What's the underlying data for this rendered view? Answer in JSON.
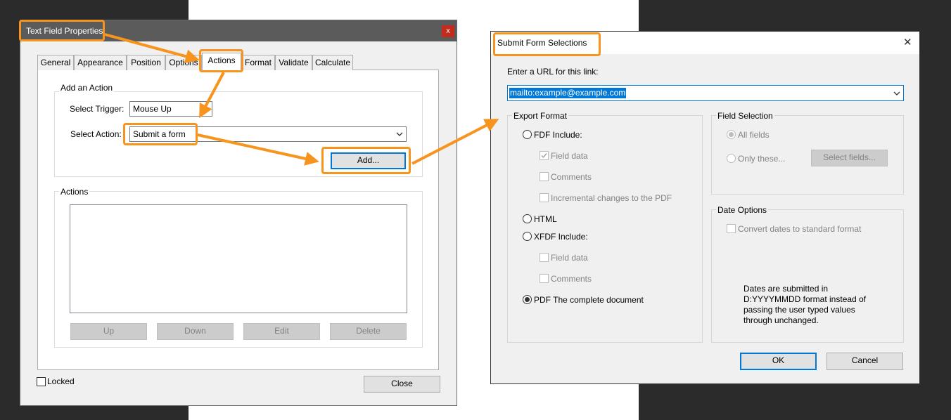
{
  "textFieldDialog": {
    "title": "Text Field Properties",
    "close_glyph": "x",
    "tabs": [
      {
        "label": "General",
        "active": false
      },
      {
        "label": "Appearance",
        "active": false
      },
      {
        "label": "Position",
        "active": false
      },
      {
        "label": "Options",
        "active": false
      },
      {
        "label": "Actions",
        "active": true
      },
      {
        "label": "Format",
        "active": false
      },
      {
        "label": "Validate",
        "active": false
      },
      {
        "label": "Calculate",
        "active": false
      }
    ],
    "addAction": {
      "group_label": "Add an Action",
      "trigger_label": "Select Trigger:",
      "trigger_value": "Mouse Up",
      "action_label": "Select Action:",
      "action_value": "Submit a form",
      "add_button": "Add..."
    },
    "actions": {
      "group_label": "Actions",
      "up_button": "Up",
      "down_button": "Down",
      "edit_button": "Edit",
      "delete_button": "Delete"
    },
    "locked_label": "Locked",
    "close_button": "Close"
  },
  "submitDialog": {
    "title": "Submit Form Selections",
    "close_glyph": "✕",
    "url_label": "Enter a URL for this link:",
    "url_value": "mailto:example@example.com",
    "exportFormat": {
      "group_label": "Export Format",
      "fdf_label": "FDF  Include:",
      "fdf_field_data": "Field data",
      "fdf_comments": "Comments",
      "fdf_incremental": "Incremental changes to the PDF",
      "html_label": "HTML",
      "xfdf_label": "XFDF  Include:",
      "xfdf_field_data": "Field data",
      "xfdf_comments": "Comments",
      "pdf_label": "PDF  The complete document",
      "selected": "PDF"
    },
    "fieldSelection": {
      "group_label": "Field Selection",
      "all_fields": "All fields",
      "only_these": "Only these...",
      "select_fields_button": "Select fields..."
    },
    "dateOptions": {
      "group_label": "Date Options",
      "convert_label": "Convert dates to standard format",
      "note_line1": "Dates are submitted in",
      "note_line2": "D:YYYYMMDD format instead of",
      "note_line3": "passing the user typed values",
      "note_line4": "through unchanged."
    },
    "ok_button": "OK",
    "cancel_button": "Cancel"
  },
  "colors": {
    "highlight": "#f7941d",
    "selection": "#0078d7",
    "titlebar_left": "#5b5b5b",
    "close_red": "#c42b1c"
  }
}
